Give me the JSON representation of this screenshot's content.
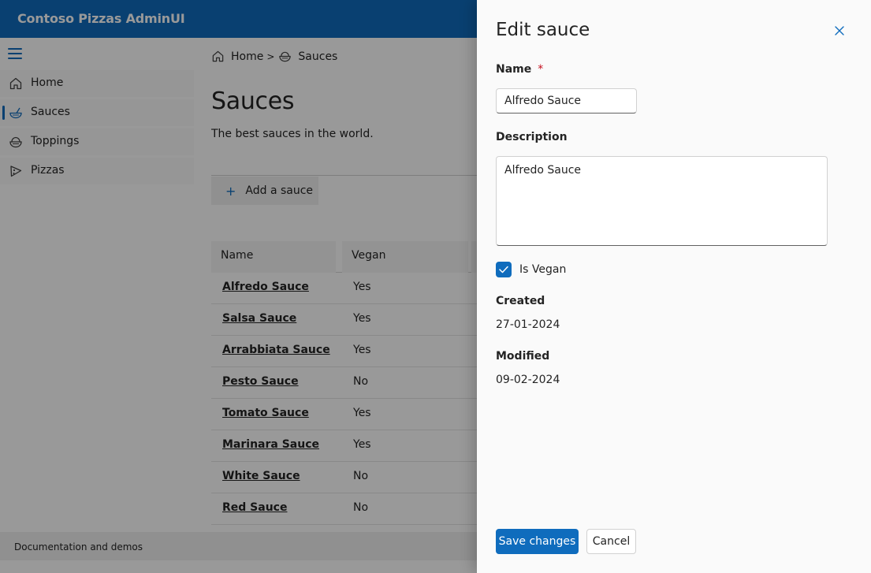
{
  "app": {
    "title": "Contoso Pizzas AdminUI",
    "brand_color": "#0f6cbd"
  },
  "sidebar": {
    "items": [
      {
        "label": "Home",
        "icon": "home-icon",
        "active": false
      },
      {
        "label": "Sauces",
        "icon": "sauce-bowl-icon",
        "active": true
      },
      {
        "label": "Toppings",
        "icon": "toppings-bowl-icon",
        "active": false
      },
      {
        "label": "Pizzas",
        "icon": "pizza-icon",
        "active": false
      }
    ]
  },
  "breadcrumb": {
    "home": "Home",
    "current": "Sauces",
    "separator": ">"
  },
  "page": {
    "title": "Sauces",
    "subtitle": "The best sauces in the world.",
    "add_label": "Add a sauce"
  },
  "grid": {
    "headers": {
      "name": "Name",
      "vegan": "Vegan"
    },
    "rows": [
      {
        "name": "Alfredo Sauce",
        "vegan": "Yes"
      },
      {
        "name": "Salsa Sauce",
        "vegan": "Yes"
      },
      {
        "name": "Arrabbiata Sauce",
        "vegan": "Yes"
      },
      {
        "name": "Pesto Sauce",
        "vegan": "No"
      },
      {
        "name": "Tomato Sauce",
        "vegan": "Yes"
      },
      {
        "name": "Marinara Sauce",
        "vegan": "Yes"
      },
      {
        "name": "White Sauce",
        "vegan": "No"
      },
      {
        "name": "Red Sauce",
        "vegan": "No"
      }
    ]
  },
  "footer": {
    "text": "Documentation and demos"
  },
  "panel": {
    "title": "Edit sauce",
    "name_label": "Name",
    "required_mark": "*",
    "name_value": "Alfredo Sauce",
    "description_label": "Description",
    "description_value": "Alfredo Sauce",
    "is_vegan_label": "Is Vegan",
    "is_vegan_checked": true,
    "created_label": "Created",
    "created_value": "27-01-2024",
    "modified_label": "Modified",
    "modified_value": "09-02-2024",
    "save_label": "Save changes",
    "cancel_label": "Cancel"
  }
}
